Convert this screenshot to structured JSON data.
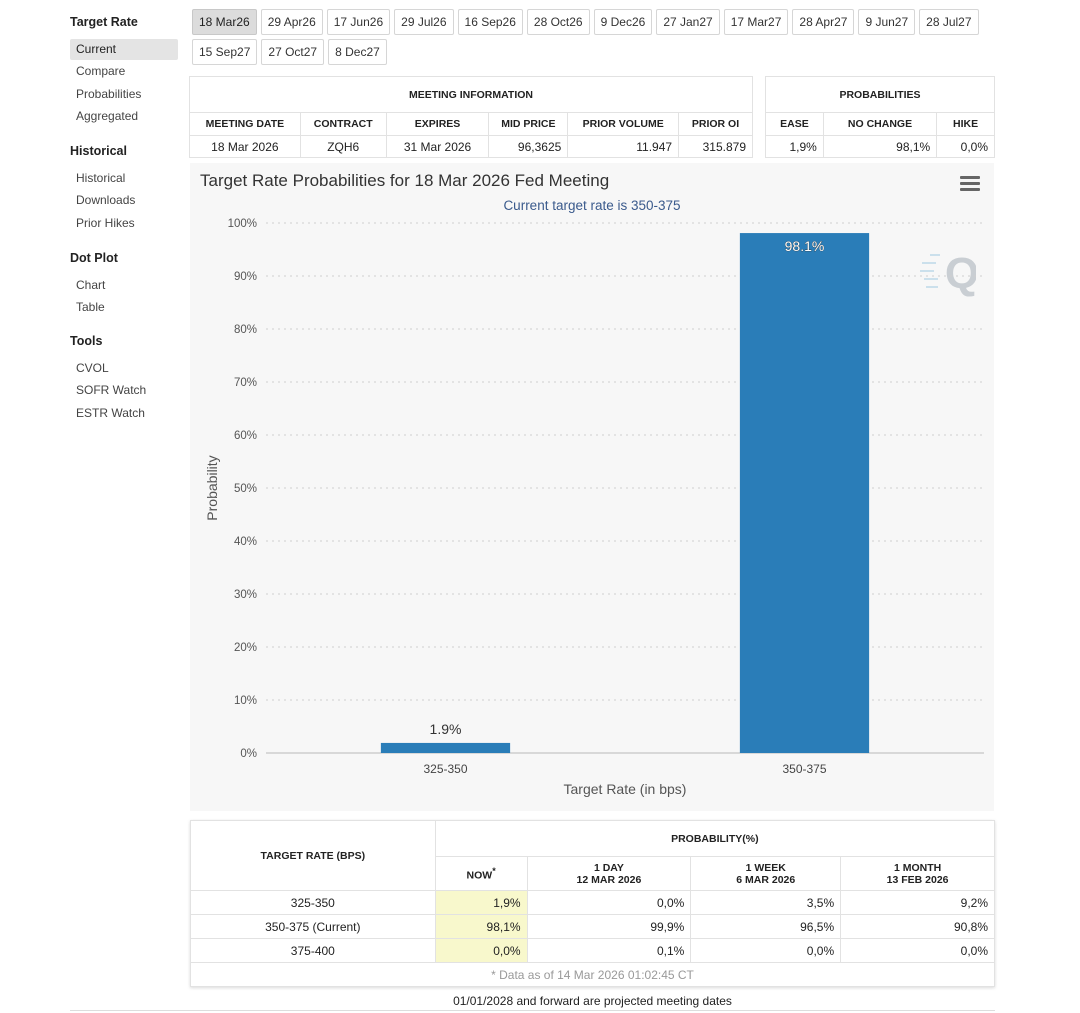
{
  "sidebar": {
    "groups": [
      {
        "heading": "Target Rate",
        "items": [
          "Current",
          "Compare",
          "Probabilities",
          "Aggregated"
        ]
      },
      {
        "heading": "Historical",
        "items": [
          "Historical",
          "Downloads",
          "Prior Hikes"
        ]
      },
      {
        "heading": "Dot Plot",
        "items": [
          "Chart",
          "Table"
        ]
      },
      {
        "heading": "Tools",
        "items": [
          "CVOL",
          "SOFR Watch",
          "ESTR Watch"
        ]
      }
    ],
    "active_item": "Current"
  },
  "date_tabs": {
    "row1": [
      "18 Mar26",
      "29 Apr26",
      "17 Jun26",
      "29 Jul26",
      "16 Sep26",
      "28 Oct26",
      "9 Dec26",
      "27 Jan27",
      "17 Mar27",
      "28 Apr27",
      "9 Jun27",
      "28 Jul27"
    ],
    "row2": [
      "15 Sep27",
      "27 Oct27",
      "8 Dec27"
    ],
    "active": "18 Mar26"
  },
  "meeting_info": {
    "heading": "MEETING INFORMATION",
    "columns": [
      "MEETING DATE",
      "CONTRACT",
      "EXPIRES",
      "MID PRICE",
      "PRIOR VOLUME",
      "PRIOR OI"
    ],
    "row": [
      "18 Mar 2026",
      "ZQH6",
      "31 Mar 2026",
      "96,3625",
      "11.947",
      "315.879"
    ]
  },
  "probabilities": {
    "heading": "PROBABILITIES",
    "columns": [
      "EASE",
      "NO CHANGE",
      "HIKE"
    ],
    "row": [
      "1,9%",
      "98,1%",
      "0,0%"
    ]
  },
  "chart": {
    "title": "Target Rate Probabilities for 18 Mar 2026 Fed Meeting",
    "subtitle": "Current target rate is 350-375",
    "watermark_letter": "Q",
    "colors": {
      "bar": "#2a7db8",
      "plot_bg": "#f7f7f7",
      "subtitle": "#3a5a8c"
    }
  },
  "chart_data": {
    "type": "bar",
    "title": "Target Rate Probabilities for 18 Mar 2026 Fed Meeting",
    "subtitle": "Current target rate is 350-375",
    "xlabel": "Target Rate (in bps)",
    "ylabel": "Probability",
    "categories": [
      "325-350",
      "350-375"
    ],
    "values": [
      1.9,
      98.1
    ],
    "data_labels": [
      "1.9%",
      "98.1%"
    ],
    "ylim": [
      0,
      100
    ],
    "yticks": [
      "0%",
      "10%",
      "20%",
      "30%",
      "40%",
      "50%",
      "60%",
      "70%",
      "80%",
      "90%",
      "100%"
    ],
    "grid": true,
    "legend": "none"
  },
  "prob_table": {
    "col_target": "TARGET RATE (BPS)",
    "group_heading": "PROBABILITY(%)",
    "col_now": "NOW",
    "now_mark": "*",
    "col_1day": [
      "1 DAY",
      "12 MAR 2026"
    ],
    "col_1week": [
      "1 WEEK",
      "6 MAR 2026"
    ],
    "col_1month": [
      "1 MONTH",
      "13 FEB 2026"
    ],
    "rows": [
      [
        "325-350",
        "1,9%",
        "0,0%",
        "3,5%",
        "9,2%"
      ],
      [
        "350-375 (Current)",
        "98,1%",
        "99,9%",
        "96,5%",
        "90,8%"
      ],
      [
        "375-400",
        "0,0%",
        "0,1%",
        "0,0%",
        "0,0%"
      ]
    ],
    "note": "* Data as of 14 Mar 2026 01:02:45 CT"
  },
  "footer": "01/01/2028 and forward are projected meeting dates"
}
